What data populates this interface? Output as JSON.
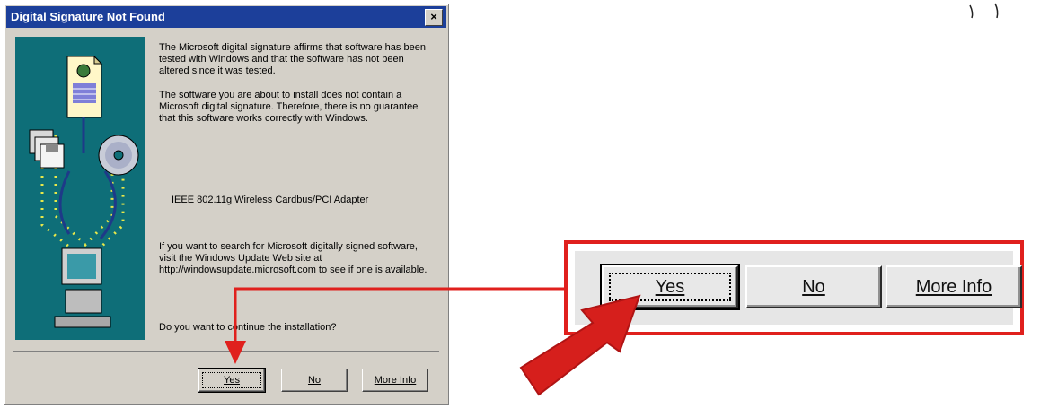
{
  "dialog": {
    "title": "Digital Signature Not Found",
    "close_label": "×",
    "paragraph1": "The Microsoft digital signature affirms that software has been tested with Windows and that the software has not been altered since it was tested.",
    "paragraph2": "The software you are about to install does not contain a Microsoft digital signature. Therefore, there is no guarantee that this software works correctly with Windows.",
    "device_name": "IEEE 802.11g Wireless Cardbus/PCI Adapter",
    "search_text": "If you want to search for Microsoft digitally signed software, visit the Windows Update Web site at http://windowsupdate.microsoft.com to see if one is available.",
    "question": "Do you want to continue the installation?",
    "buttons": {
      "yes": "Yes",
      "no": "No",
      "more_info": "More Info"
    }
  },
  "zoom": {
    "buttons": {
      "yes": "Yes",
      "no": "No",
      "more_info": "More Info"
    }
  },
  "colors": {
    "titlebar": "#1c3f9a",
    "dialog_face": "#d4d0c8",
    "illustration_bg": "#0e6e78",
    "highlight_red": "#e0201d"
  },
  "icons": [
    "document-icon",
    "floppy-disks-icon",
    "cd-icon",
    "computer-icon",
    "arrow-icon"
  ]
}
